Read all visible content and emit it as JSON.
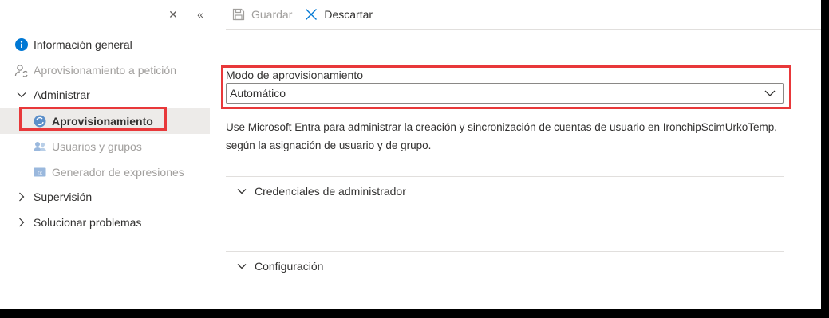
{
  "sidebar": {
    "collapse_icon": "close-icon",
    "double_chevron_icon": "double-chevron-left-icon",
    "items": [
      {
        "label": "Información general",
        "icon": "info-icon"
      },
      {
        "label": "Aprovisionamiento a petición",
        "icon": "user-sync-icon"
      },
      {
        "label": "Administrar",
        "icon": "chevron-down-icon"
      },
      {
        "label": "Aprovisionamiento",
        "icon": "provisioning-icon"
      },
      {
        "label": "Usuarios y grupos",
        "icon": "users-icon"
      },
      {
        "label": "Generador de expresiones",
        "icon": "expression-icon"
      },
      {
        "label": "Supervisión",
        "icon": "chevron-right-icon"
      },
      {
        "label": "Solucionar problemas",
        "icon": "chevron-right-icon"
      }
    ]
  },
  "toolbar": {
    "save_label": "Guardar",
    "discard_label": "Descartar"
  },
  "form": {
    "mode_label": "Modo de aprovisionamiento",
    "mode_value": "Automático",
    "description": "Use Microsoft Entra para administrar la creación y sincronización de cuentas de usuario en IronchipScimUrkoTemp, según la asignación de usuario y de grupo."
  },
  "sections": [
    {
      "label": "Credenciales de administrador"
    },
    {
      "label": "Configuración"
    }
  ],
  "colors": {
    "highlight_border": "#e8383a",
    "info_blue": "#0078d4",
    "active_bg": "#edebe9"
  }
}
